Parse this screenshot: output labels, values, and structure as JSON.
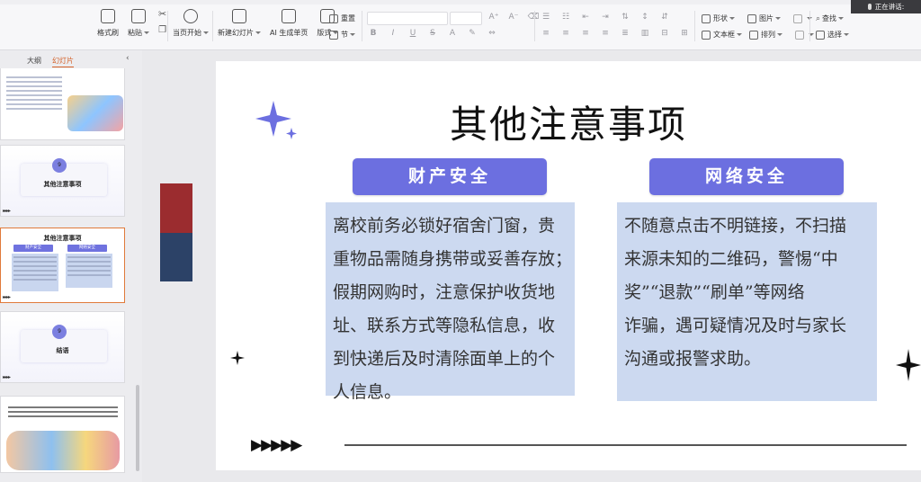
{
  "colors": {
    "accent_purple": "#6c6fe0",
    "body_box": "#ccd9f0",
    "selected_border": "#e07a3a",
    "stripe_red": "#9b2c2f",
    "stripe_blue": "#2c4267"
  },
  "status": {
    "speaking": "正在讲话:"
  },
  "ribbon": {
    "format_painter": "格式刷",
    "paste": "粘贴",
    "start_from_current": "当页开始",
    "new_slide": "新建幻灯片",
    "ai_single_page": "AI 生成单页",
    "layout": "版式",
    "section": "节",
    "reset": "重置",
    "shape": "形状",
    "picture": "图片",
    "textbox": "文本框",
    "arrange": "排列",
    "find": "查找",
    "select": "选择",
    "font_glyphs": [
      "B",
      "I",
      "U",
      "S",
      "A"
    ]
  },
  "left_panel": {
    "tabs": [
      "大纲",
      "幻灯片"
    ],
    "active_tab": "幻灯片",
    "collapse_icon": "chevron-left",
    "thumbnails": [
      {
        "kind": "text-with-illustration"
      },
      {
        "kind": "section",
        "number": "9",
        "title": "其他注意事项"
      },
      {
        "kind": "content",
        "title": "其他注意事项",
        "left_head": "财产安全",
        "right_head": "网络安全",
        "selected": true
      },
      {
        "kind": "section",
        "number": "9",
        "title": "结语"
      },
      {
        "kind": "closing-with-photo"
      }
    ]
  },
  "slide": {
    "title": "其他注意事项",
    "left": {
      "heading": "财产安全",
      "lines": [
        "离校前务必锁好宿舍门窗，贵",
        "重物品需随身携带或妥善存放；",
        "假期网购时，注意保护收货地",
        "址、联系方式等隐私信息，收",
        "到快递后及时清除面单上的个",
        "人信息。"
      ]
    },
    "right": {
      "heading": "网络安全",
      "lines": [
        "不随意点击不明链接，不扫描",
        "来源未知的二维码，警惕“中",
        "奖”“退款”“刷单”等网络",
        "诈骗，遇可疑情况及时与家长",
        "沟通或报警求助。"
      ]
    },
    "arrows": "▶▶▶▶▶"
  }
}
